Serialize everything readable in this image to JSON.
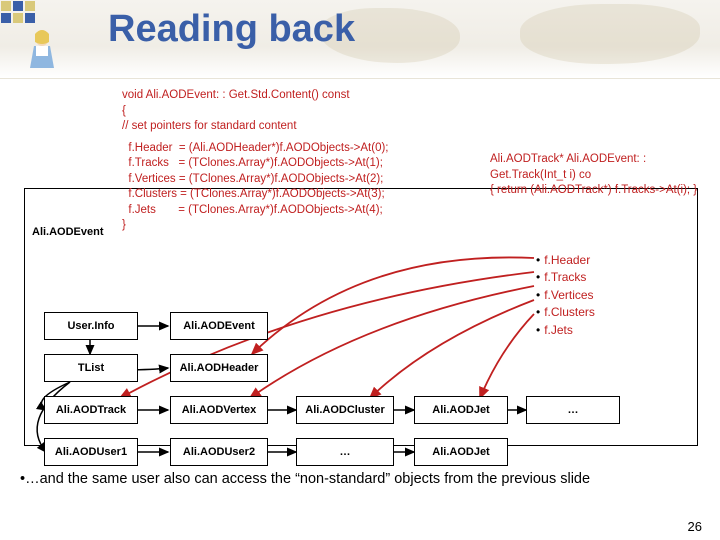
{
  "title": "Reading back",
  "code_main": [
    "void Ali.AODEvent: : Get.Std.Content() const",
    "{",
    "  // set pointers for standard content",
    "",
    "  f.Header  = (Ali.AODHeader*)f.AODObjects->At(0);",
    "  f.Tracks   = (TClones.Array*)f.AODObjects->At(1);",
    "  f.Vertices = (TClones.Array*)f.AODObjects->At(2);",
    "  f.Clusters = (TClones.Array*)f.AODObjects->At(3);",
    "  f.Jets       = (TClones.Array*)f.AODObjects->At(4);",
    "}"
  ],
  "code_frag": [
    "Ali.AODTrack* Ali.AODEvent: : Get.Track(Int_t i) co",
    "{ return (Ali.AODTrack*) f.Tracks->At(i); }"
  ],
  "parent_label": "Ali.AODEvent",
  "members": {
    "m0": "f.Header",
    "m1": "f.Tracks",
    "m2": "f.Vertices",
    "m3": "f.Clusters",
    "m4": "f.Jets"
  },
  "nodes": {
    "userinfo": "User.Info",
    "tlist": "TList",
    "aodtrack": "Ali.AODTrack",
    "aoduser1": "Ali.AODUser1",
    "aodevent": "Ali.AODEvent",
    "aodheader": "Ali.AODHeader",
    "aodvertex": "Ali.AODVertex",
    "aoduser2": "Ali.AODUser2",
    "aodcluster": "Ali.AODCluster",
    "ellipsis": "…",
    "aodjet": "Ali.AODJet",
    "aodjet2": "Ali.AODJet",
    "ellipsis2": "…"
  },
  "footer_bullet": "•…and the same user also can access the “non-standard” objects from the previous slide",
  "slide_number": "26",
  "colors": {
    "accent": "#3a5fa8",
    "code": "#c02020"
  }
}
